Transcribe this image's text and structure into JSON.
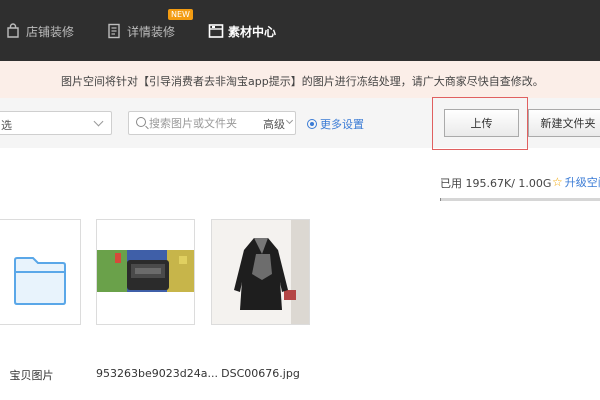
{
  "nav": {
    "items": [
      {
        "label": "店铺装修",
        "icon": "store-icon"
      },
      {
        "label": "详情装修",
        "icon": "document-icon",
        "badge": "NEW"
      },
      {
        "label": "素材中心",
        "icon": "folder-icon",
        "active": true
      }
    ]
  },
  "notice": {
    "text": "图片空间将针对【引导消费者去非淘宝app提示】的图片进行冻结处理，请广大商家尽快自查修改。"
  },
  "toolbar": {
    "filter_value": "选",
    "search_placeholder": "搜索图片或文件夹",
    "advanced_label": "高级",
    "more_settings_label": "更多设置",
    "upload_label": "上传",
    "new_folder_label": "新建文件夹"
  },
  "usage": {
    "text": "已用 195.67K/ 1.00G",
    "fraction": 0.0002,
    "upgrade_label": "升级空间"
  },
  "files": [
    {
      "name": "宝贝图片",
      "type": "folder"
    },
    {
      "name": "953263be9023d24a...",
      "type": "image"
    },
    {
      "name": "DSC00676.jpg",
      "type": "image"
    }
  ],
  "colors": {
    "topbar": "#2f2f2f",
    "notice_bg": "#fbeee8",
    "accent_blue": "#3a7bd5",
    "highlight_red": "#e06060",
    "badge_orange": "#f39c12"
  }
}
